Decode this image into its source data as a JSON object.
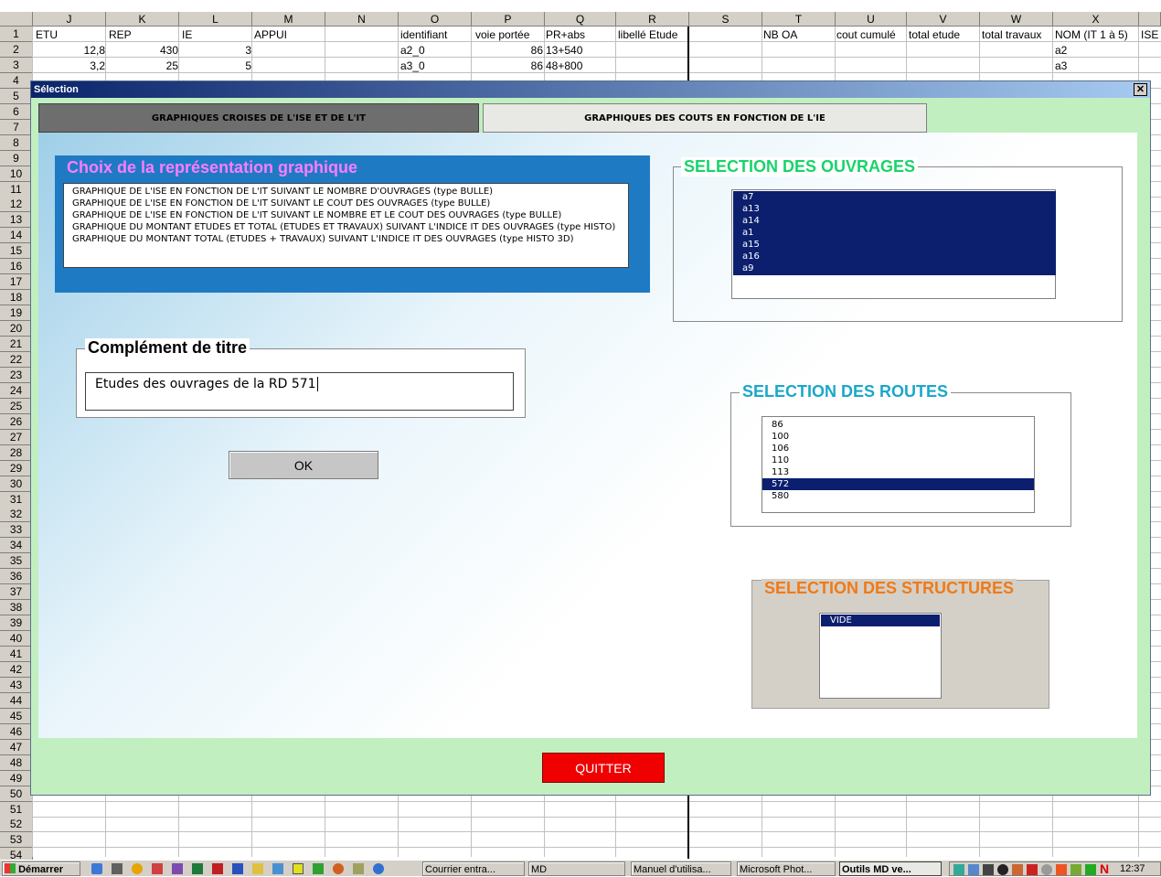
{
  "sheet": {
    "columns": [
      "J",
      "K",
      "L",
      "M",
      "N",
      "O",
      "P",
      "Q",
      "R",
      "S",
      "T",
      "U",
      "V",
      "W",
      "X"
    ],
    "header_row": [
      "ETU",
      "REP",
      "IE",
      "APPUI",
      "",
      "identifiant",
      "voie portée",
      "PR+abs",
      "libellé Etude",
      "",
      "NB OA",
      "cout cumulé",
      "total etude",
      "total travaux",
      "NOM (IT 1 à 5)",
      "ISE"
    ],
    "row2": {
      "J": "12,8",
      "K": "430",
      "L": "3",
      "O": "a2_0",
      "P": "86",
      "Q": "13+540",
      "X": "a2"
    },
    "row3": {
      "J": "3,2",
      "K": "25",
      "L": "5",
      "O": "a3_0",
      "P": "86",
      "Q": "48+800",
      "X": "a3"
    },
    "row_numbers_top": [
      "1",
      "2",
      "3",
      "4",
      "5",
      "6",
      "7",
      "8",
      "9",
      "10",
      "11",
      "12",
      "13",
      "14",
      "15",
      "16",
      "17",
      "18",
      "19",
      "20",
      "21",
      "22",
      "23",
      "24",
      "25",
      "26",
      "27",
      "28",
      "29",
      "30",
      "31",
      "32",
      "33",
      "34",
      "35",
      "36",
      "37",
      "38",
      "39",
      "40",
      "41",
      "42",
      "43",
      "44",
      "45",
      "46",
      "47",
      "48",
      "49",
      "50",
      "51",
      "52",
      "53",
      "54"
    ]
  },
  "dialog": {
    "title": "Sélection",
    "close_glyph": "✕",
    "tabs": [
      {
        "label": "GRAPHIQUES CROISES DE L'ISE ET DE L'IT"
      },
      {
        "label": "GRAPHIQUES DES COUTS EN FONCTION DE L'IE"
      }
    ],
    "choix": {
      "title": "Choix de la représentation graphique",
      "options": [
        "GRAPHIQUE DE L'ISE EN FONCTION DE L'IT SUIVANT LE NOMBRE D'OUVRAGES (type BULLE)",
        "GRAPHIQUE DE L'ISE EN FONCTION DE L'IT SUIVANT LE COUT DES OUVRAGES (type BULLE)",
        "GRAPHIQUE DE L'ISE EN FONCTION DE L'IT SUIVANT LE NOMBRE ET LE COUT DES OUVRAGES (type BULLE)",
        "GRAPHIQUE DU MONTANT ETUDES ET TOTAL (ETUDES ET TRAVAUX) SUIVANT L'INDICE IT DES OUVRAGES (type HISTO)",
        "GRAPHIQUE DU MONTANT TOTAL (ETUDES + TRAVAUX) SUIVANT L'INDICE IT DES OUVRAGES (type HISTO 3D)"
      ]
    },
    "ouvrages": {
      "title": "SELECTION DES OUVRAGES",
      "items": [
        "a7",
        "a13",
        "a14",
        "a1",
        "a15",
        "a16",
        "a9"
      ]
    },
    "complement": {
      "title": "Complément de titre",
      "value": "Etudes des ouvrages de la RD 571"
    },
    "ok_label": "OK",
    "routes": {
      "title": "SELECTION DES ROUTES",
      "items": [
        "86",
        "100",
        "106",
        "110",
        "113",
        "572",
        "580"
      ],
      "selected": "572"
    },
    "structures": {
      "title": "SELECTION DES STRUCTURES",
      "items": [
        "VIDE"
      ]
    },
    "quit_label": "QUITTER"
  },
  "taskbar": {
    "start_label": "Démarrer",
    "windows": [
      "Courrier entra...",
      "MD",
      "Manuel d'utilisa...",
      "Microsoft Phot...",
      "Outils MD  ve..."
    ],
    "clock": "12:37"
  },
  "colors": {
    "selection": "#0c1f6e",
    "choix_title": "#ff7cff",
    "ouvrages_title": "#19d36a",
    "routes_title": "#1ba7c9",
    "structures_title": "#f07a16",
    "quit_bg": "#f00000"
  }
}
